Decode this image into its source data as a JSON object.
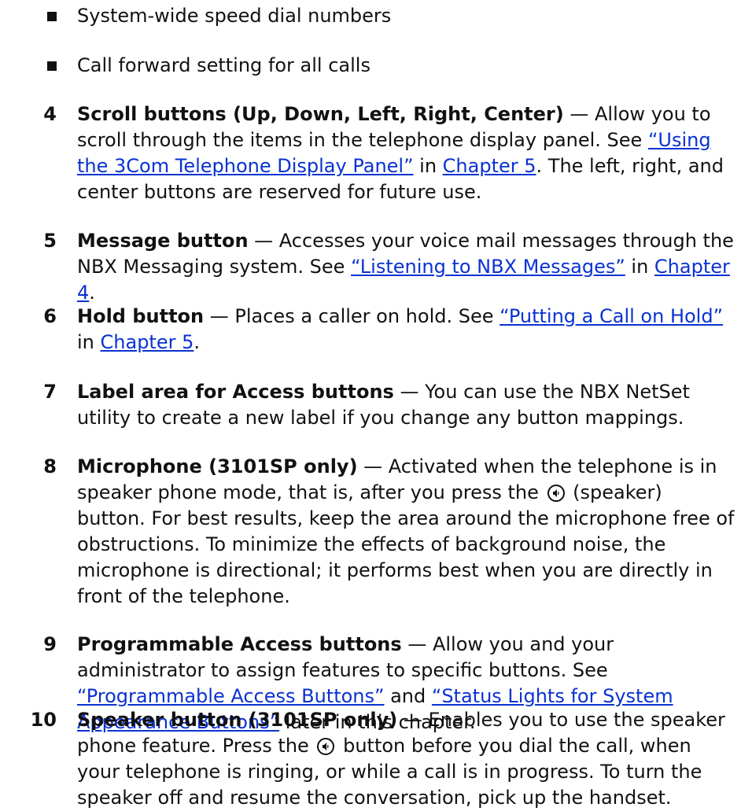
{
  "bullets": [
    "System-wide speed dial numbers",
    "Call forward setting for all calls"
  ],
  "items": {
    "i4": {
      "num": "4",
      "label": "Scroll buttons (Up, Down, Left, Right, Center)",
      "t1": " — Allow you to scroll through the items in the telephone display panel. See ",
      "link1": "“Using the 3Com Telephone Display Panel”",
      "t2": " in ",
      "link2": "Chapter 5",
      "t3": ". The left, right, and center buttons are reserved for future use."
    },
    "i5": {
      "num": "5",
      "label": "Message button",
      "t1": " — Accesses your voice mail messages through the NBX Messaging system. See ",
      "link1": "“Listening to NBX Messages”",
      "t2": " in ",
      "link2": "Chapter 4",
      "t3": "."
    },
    "i6": {
      "num": "6",
      "label": "Hold button",
      "t1": " — Places a caller on hold. See ",
      "link1": "“Putting a Call on Hold”",
      "t2": " in ",
      "link2": "Chapter 5",
      "t3": "."
    },
    "i7": {
      "num": "7",
      "label": "Label area for Access buttons",
      "t1": " — You can use the NBX NetSet utility to create a new label if you change any button mappings."
    },
    "i8": {
      "num": "8",
      "label": "Microphone (3101SP only)",
      "t1": " — Activated when the telephone is in speaker phone mode, that is, after you press the",
      "t2": "(speaker) button. For best results, keep the area around the microphone free of obstructions. To minimize the effects of background noise, the microphone is directional; it performs best when you are directly in front of the telephone."
    },
    "i9": {
      "num": "9",
      "label": "Programmable Access buttons",
      "t1": " — Allow you and your administrator to assign features to specific buttons. See ",
      "link1": "“Programmable Access Buttons”",
      "t2": " and ",
      "link2": "“Status Lights for System Appearance Buttons”",
      "t3": " later in this chapter."
    },
    "i10": {
      "num": "10",
      "label": "Speaker button (3101SP only)",
      "t1": " — Enables you to use the speaker phone feature. Press the",
      "t2": "button before you dial the call, when your telephone is ringing, or while a call is in progress. To turn the speaker off and resume the conversation, pick up the handset."
    }
  },
  "icons": {
    "speaker": "speaker-icon"
  },
  "colors": {
    "text": "#111111",
    "link": "#0a32d2"
  }
}
